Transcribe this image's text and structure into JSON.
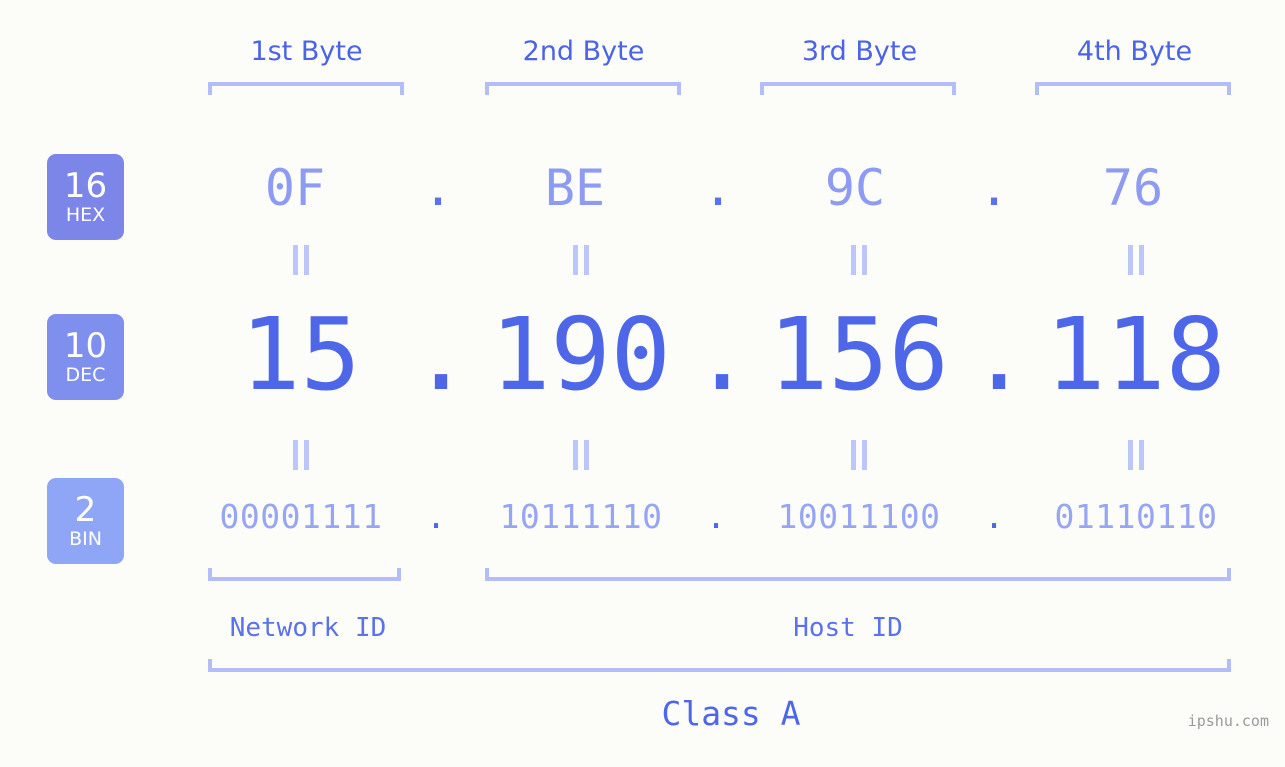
{
  "page": {
    "background_color": "#fcfdf9",
    "accent_color": "#4d67e8",
    "accent_light": "#b3bdfa",
    "watermark": "ipshu.com"
  },
  "byte_headers": [
    {
      "label": "1st Byte"
    },
    {
      "label": "2nd Byte"
    },
    {
      "label": "3rd Byte"
    },
    {
      "label": "4th Byte"
    }
  ],
  "rows": [
    {
      "badge_number": "16",
      "badge_name": "HEX",
      "badge_color": "#7b86e8",
      "separator": ".",
      "values": [
        "0F",
        "BE",
        "9C",
        "76"
      ]
    },
    {
      "badge_number": "10",
      "badge_name": "DEC",
      "badge_color": "#7f8fee",
      "separator": ".",
      "values": [
        "15",
        "190",
        "156",
        "118"
      ]
    },
    {
      "badge_number": "2",
      "badge_name": "BIN",
      "badge_color": "#8fa6f6",
      "separator": ".",
      "values": [
        "00001111",
        "10111110",
        "10011100",
        "01110110"
      ]
    }
  ],
  "equals_mark": "‖",
  "id_sections": [
    {
      "label": "Network ID"
    },
    {
      "label": "Host ID"
    }
  ],
  "class": {
    "label": "Class A"
  },
  "ip": {
    "decimal": "15.190.156.118",
    "hex": "0F.BE.9C.76",
    "binary": "00001111.10111110.10011100.01110110"
  }
}
